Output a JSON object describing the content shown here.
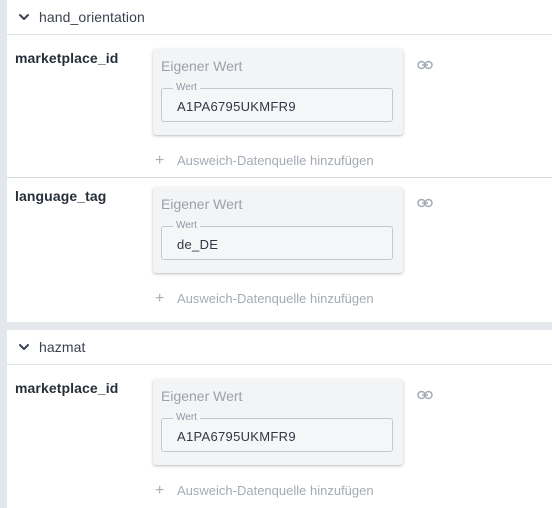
{
  "sections": [
    {
      "title": "hand_orientation",
      "fields": [
        {
          "label": "marketplace_id",
          "card_title": "Eigener Wert",
          "value_legend": "Wert",
          "value": "A1PA6795UKMFR9",
          "add_fallback": "Ausweich-Datenquelle hinzufügen"
        },
        {
          "label": "language_tag",
          "card_title": "Eigener Wert",
          "value_legend": "Wert",
          "value": "de_DE",
          "add_fallback": "Ausweich-Datenquelle hinzufügen"
        }
      ]
    },
    {
      "title": "hazmat",
      "fields": [
        {
          "label": "marketplace_id",
          "card_title": "Eigener Wert",
          "value_legend": "Wert",
          "value": "A1PA6795UKMFR9",
          "add_fallback": "Ausweich-Datenquelle hinzufügen"
        }
      ]
    }
  ],
  "icons": {
    "collapse": "chevron-down-icon",
    "link": "link-icon",
    "add": "plus-icon"
  },
  "colors": {
    "panel": "#ffffff",
    "background": "#e5e8ec",
    "card": "#f3f4f6",
    "muted_text": "#a3abb5"
  }
}
